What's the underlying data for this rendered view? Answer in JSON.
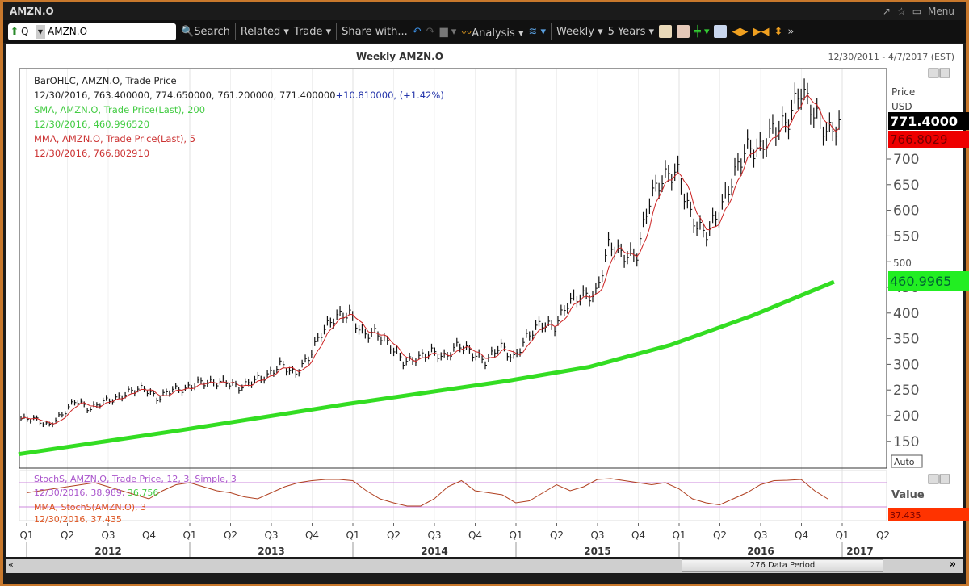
{
  "window": {
    "title": "AMZN.O",
    "menu_label": "Menu"
  },
  "toolbar": {
    "ric_value": "AMZN.O",
    "q_label": "Q",
    "search": "Search",
    "related": "Related ▾",
    "trade": "Trade ▾",
    "share": "Share with...",
    "analysis": "Analysis ▾",
    "interval": "Weekly ▾",
    "range": "5 Years ▾"
  },
  "chart_data": {
    "type": "line",
    "title": "Weekly AMZN.O",
    "date_range": "12/30/2011 - 4/7/2017 (EST)",
    "legend": {
      "bar": "BarOHLC, AMZN.O, Trade Price",
      "bar_values": "12/30/2016, 763.400000, 774.650000, 761.200000, 771.400000",
      "bar_change": "+10.810000, (+1.42%)",
      "sma": "SMA, AMZN.O, Trade Price(Last),  200",
      "sma_value": "12/30/2016, 460.996520",
      "mma": "MMA, AMZN.O, Trade Price(Last),  5",
      "mma_value": "12/30/2016, 766.802910",
      "stoch": "StochS, AMZN.O, Trade Price,  12, 3, Simple, 3",
      "stoch_value": "12/30/2016, 38.989, ",
      "stoch_value2": "36.756",
      "stoch_mma": "MMA, StochS(AMZN.O),  3",
      "stoch_mma_value": "12/30/2016, 37.435"
    },
    "yaxis": {
      "label": "Price",
      "unit": "USD",
      "ylim": [
        120,
        860
      ],
      "ticks": [
        150,
        200,
        250,
        300,
        350,
        400,
        450,
        500,
        550,
        600,
        650,
        700
      ],
      "auto_label": "Auto"
    },
    "price_tags": {
      "last": "771.4000",
      "mma": "766.8029",
      "sma": "460.9965"
    },
    "lower_pane": {
      "label": "Value",
      "tag": "37.435",
      "ylim": [
        0,
        100
      ],
      "levels": [
        20,
        80
      ]
    },
    "x_start": 2012.0,
    "x_step": 0.0833,
    "close": [
      194,
      180,
      202,
      231,
      212,
      228,
      233,
      248,
      254,
      232,
      252,
      251,
      265,
      264,
      266,
      254,
      269,
      277,
      301,
      280,
      312,
      364,
      393,
      399,
      358,
      362,
      336,
      304,
      312,
      325,
      313,
      339,
      322,
      305,
      338,
      310,
      354,
      380,
      372,
      421,
      434,
      434,
      536,
      512,
      512,
      626,
      664,
      676,
      587,
      552,
      593,
      659,
      722,
      716,
      758,
      769,
      837,
      789,
      750,
      771.4
    ],
    "sma200": [
      {
        "x": 2012.0,
        "y": 125
      },
      {
        "x": 2013.0,
        "y": 172
      },
      {
        "x": 2014.0,
        "y": 222
      },
      {
        "x": 2015.0,
        "y": 268
      },
      {
        "x": 2015.5,
        "y": 295
      },
      {
        "x": 2016.0,
        "y": 338
      },
      {
        "x": 2016.5,
        "y": 395
      },
      {
        "x": 2017.0,
        "y": 461
      }
    ],
    "stoch": [
      55,
      60,
      65,
      70,
      75,
      80,
      70,
      60,
      50,
      40,
      60,
      75,
      80,
      70,
      60,
      55,
      45,
      40,
      55,
      70,
      80,
      85,
      88,
      88,
      85,
      60,
      40,
      30,
      22,
      22,
      40,
      70,
      85,
      60,
      55,
      50,
      30,
      35,
      55,
      75,
      60,
      70,
      88,
      90,
      85,
      80,
      75,
      80,
      65,
      40,
      30,
      25,
      40,
      55,
      75,
      85,
      86,
      88,
      60,
      39
    ],
    "quarters": [
      "Q1",
      "Q2",
      "Q3",
      "Q4",
      "Q1",
      "Q2",
      "Q3",
      "Q4",
      "Q1",
      "Q2",
      "Q3",
      "Q4",
      "Q1",
      "Q2",
      "Q3",
      "Q4",
      "Q1",
      "Q2",
      "Q3",
      "Q4",
      "Q1",
      "Q2"
    ],
    "years": [
      "2012",
      "2013",
      "2014",
      "2015",
      "2016",
      "2017"
    ]
  },
  "scroll": {
    "label": "276 Data Period"
  },
  "colors": {
    "sma": "#33dd22",
    "mma": "#cc2222",
    "stoch": "#aa55cc",
    "bars": "#111111"
  }
}
